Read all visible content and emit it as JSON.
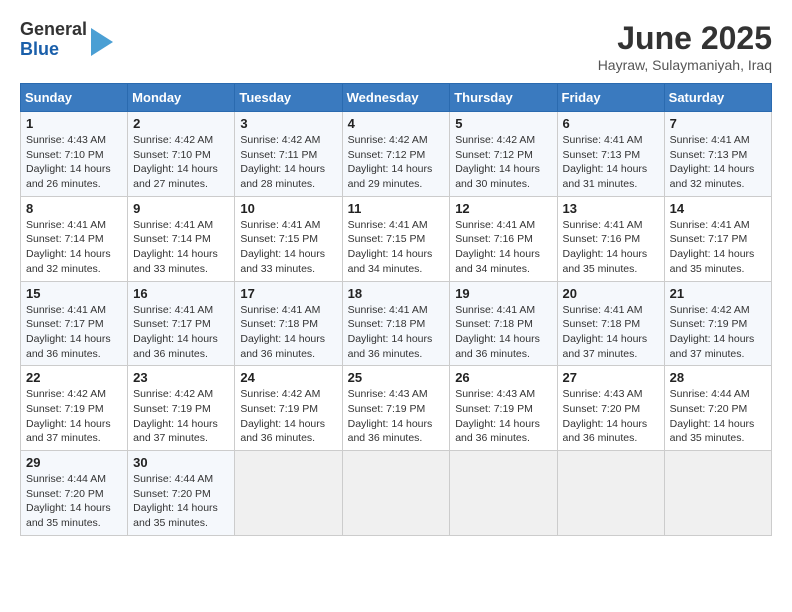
{
  "header": {
    "logo_general": "General",
    "logo_blue": "Blue",
    "month_title": "June 2025",
    "location": "Hayraw, Sulaymaniyah, Iraq"
  },
  "calendar": {
    "days_of_week": [
      "Sunday",
      "Monday",
      "Tuesday",
      "Wednesday",
      "Thursday",
      "Friday",
      "Saturday"
    ],
    "weeks": [
      [
        null,
        {
          "day": "2",
          "sunrise": "4:42 AM",
          "sunset": "7:10 PM",
          "daylight": "14 hours and 27 minutes."
        },
        {
          "day": "3",
          "sunrise": "4:42 AM",
          "sunset": "7:11 PM",
          "daylight": "14 hours and 28 minutes."
        },
        {
          "day": "4",
          "sunrise": "4:42 AM",
          "sunset": "7:12 PM",
          "daylight": "14 hours and 29 minutes."
        },
        {
          "day": "5",
          "sunrise": "4:42 AM",
          "sunset": "7:12 PM",
          "daylight": "14 hours and 30 minutes."
        },
        {
          "day": "6",
          "sunrise": "4:41 AM",
          "sunset": "7:13 PM",
          "daylight": "14 hours and 31 minutes."
        },
        {
          "day": "7",
          "sunrise": "4:41 AM",
          "sunset": "7:13 PM",
          "daylight": "14 hours and 32 minutes."
        }
      ],
      [
        {
          "day": "1",
          "sunrise": "4:43 AM",
          "sunset": "7:10 PM",
          "daylight": "14 hours and 26 minutes."
        },
        {
          "day": "8",
          "sunrise": "4:41 AM",
          "sunset": "7:14 PM",
          "daylight": "14 hours and 32 minutes."
        },
        {
          "day": "9",
          "sunrise": "4:41 AM",
          "sunset": "7:14 PM",
          "daylight": "14 hours and 33 minutes."
        },
        {
          "day": "10",
          "sunrise": "4:41 AM",
          "sunset": "7:15 PM",
          "daylight": "14 hours and 33 minutes."
        },
        {
          "day": "11",
          "sunrise": "4:41 AM",
          "sunset": "7:15 PM",
          "daylight": "14 hours and 34 minutes."
        },
        {
          "day": "12",
          "sunrise": "4:41 AM",
          "sunset": "7:16 PM",
          "daylight": "14 hours and 34 minutes."
        },
        {
          "day": "13",
          "sunrise": "4:41 AM",
          "sunset": "7:16 PM",
          "daylight": "14 hours and 35 minutes."
        },
        {
          "day": "14",
          "sunrise": "4:41 AM",
          "sunset": "7:17 PM",
          "daylight": "14 hours and 35 minutes."
        }
      ],
      [
        {
          "day": "15",
          "sunrise": "4:41 AM",
          "sunset": "7:17 PM",
          "daylight": "14 hours and 36 minutes."
        },
        {
          "day": "16",
          "sunrise": "4:41 AM",
          "sunset": "7:17 PM",
          "daylight": "14 hours and 36 minutes."
        },
        {
          "day": "17",
          "sunrise": "4:41 AM",
          "sunset": "7:18 PM",
          "daylight": "14 hours and 36 minutes."
        },
        {
          "day": "18",
          "sunrise": "4:41 AM",
          "sunset": "7:18 PM",
          "daylight": "14 hours and 36 minutes."
        },
        {
          "day": "19",
          "sunrise": "4:41 AM",
          "sunset": "7:18 PM",
          "daylight": "14 hours and 36 minutes."
        },
        {
          "day": "20",
          "sunrise": "4:41 AM",
          "sunset": "7:18 PM",
          "daylight": "14 hours and 37 minutes."
        },
        {
          "day": "21",
          "sunrise": "4:42 AM",
          "sunset": "7:19 PM",
          "daylight": "14 hours and 37 minutes."
        }
      ],
      [
        {
          "day": "22",
          "sunrise": "4:42 AM",
          "sunset": "7:19 PM",
          "daylight": "14 hours and 37 minutes."
        },
        {
          "day": "23",
          "sunrise": "4:42 AM",
          "sunset": "7:19 PM",
          "daylight": "14 hours and 37 minutes."
        },
        {
          "day": "24",
          "sunrise": "4:42 AM",
          "sunset": "7:19 PM",
          "daylight": "14 hours and 36 minutes."
        },
        {
          "day": "25",
          "sunrise": "4:43 AM",
          "sunset": "7:19 PM",
          "daylight": "14 hours and 36 minutes."
        },
        {
          "day": "26",
          "sunrise": "4:43 AM",
          "sunset": "7:19 PM",
          "daylight": "14 hours and 36 minutes."
        },
        {
          "day": "27",
          "sunrise": "4:43 AM",
          "sunset": "7:20 PM",
          "daylight": "14 hours and 36 minutes."
        },
        {
          "day": "28",
          "sunrise": "4:44 AM",
          "sunset": "7:20 PM",
          "daylight": "14 hours and 35 minutes."
        }
      ],
      [
        {
          "day": "29",
          "sunrise": "4:44 AM",
          "sunset": "7:20 PM",
          "daylight": "14 hours and 35 minutes."
        },
        {
          "day": "30",
          "sunrise": "4:44 AM",
          "sunset": "7:20 PM",
          "daylight": "14 hours and 35 minutes."
        },
        null,
        null,
        null,
        null,
        null
      ]
    ]
  }
}
